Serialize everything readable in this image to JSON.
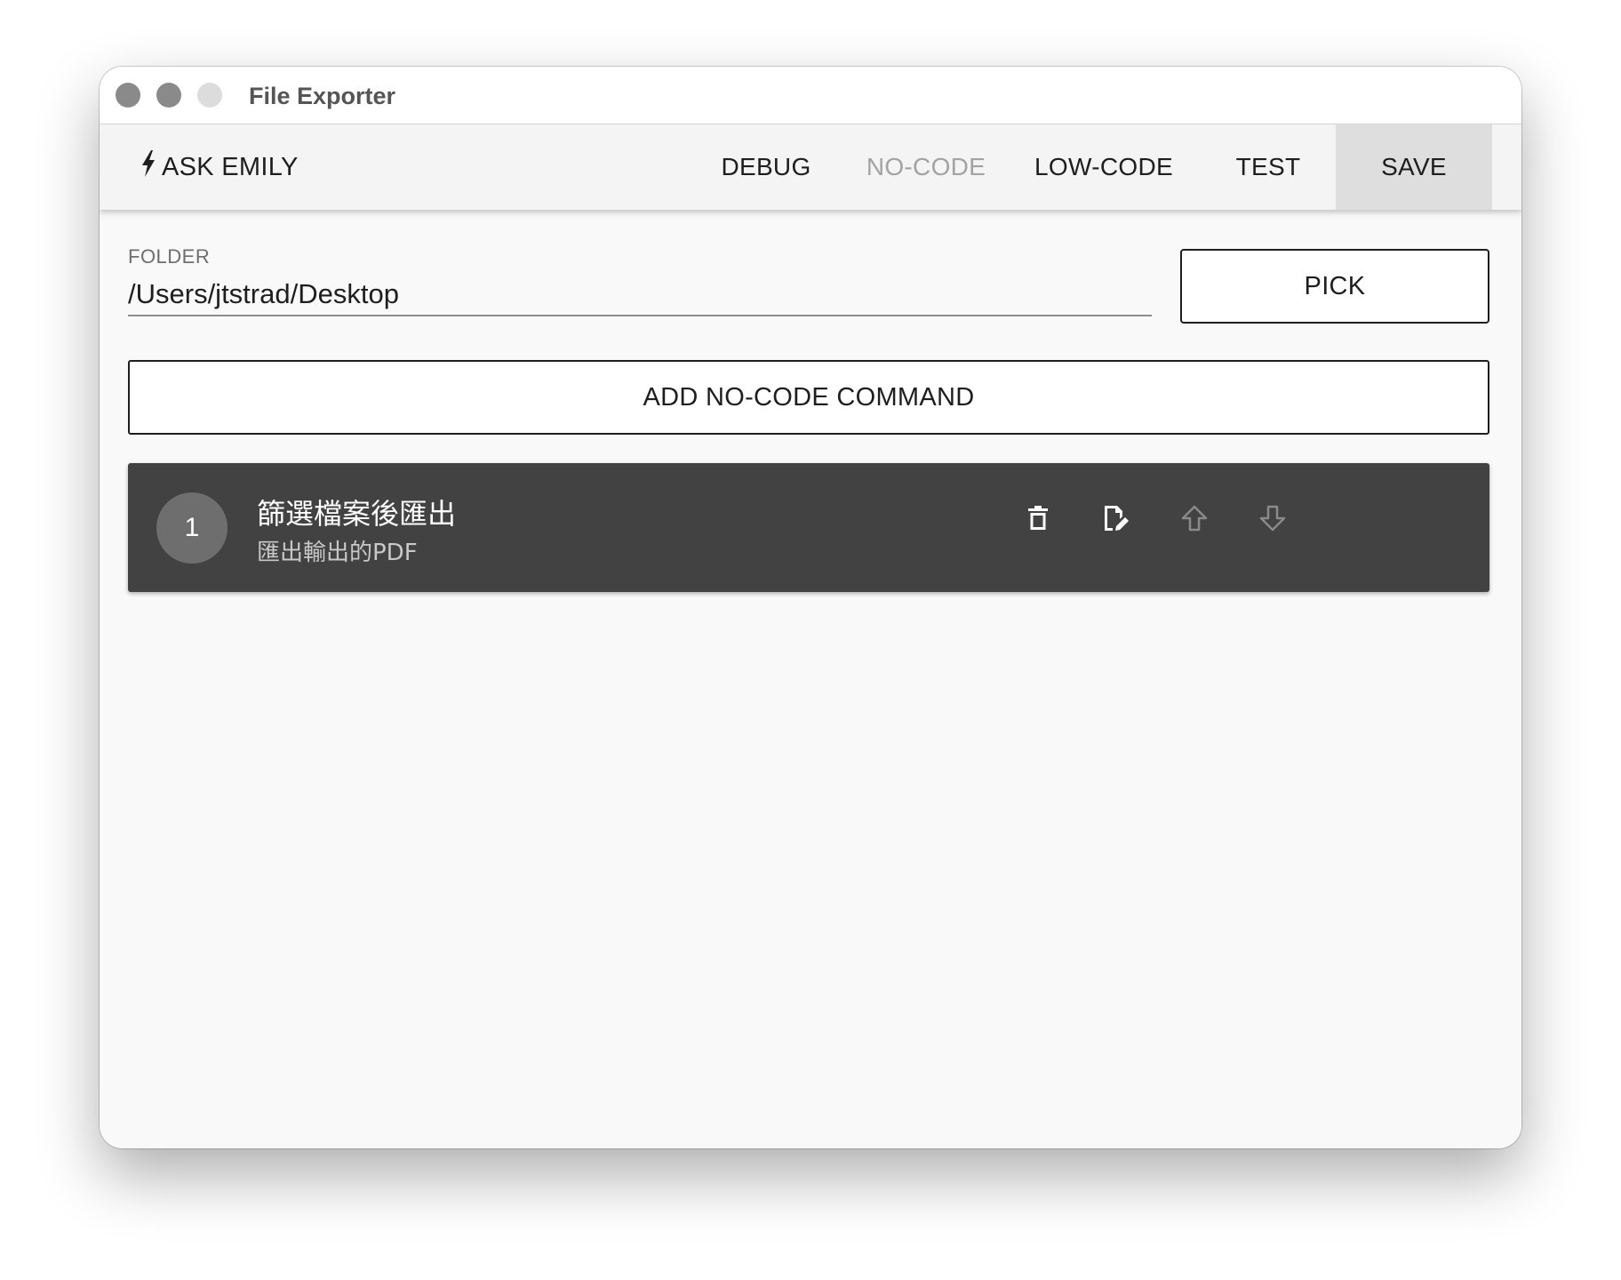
{
  "window": {
    "title": "File Exporter"
  },
  "toolbar": {
    "ask_label": "ASK EMILY",
    "ask_icon": "lightning-icon",
    "nav": [
      {
        "label": "DEBUG",
        "state": "enabled"
      },
      {
        "label": "NO-CODE",
        "state": "disabled"
      },
      {
        "label": "LOW-CODE",
        "state": "enabled"
      },
      {
        "label": "TEST",
        "state": "enabled"
      },
      {
        "label": "SAVE",
        "state": "active"
      }
    ]
  },
  "folder": {
    "label": "FOLDER",
    "value": "/Users/jtstrad/Desktop",
    "pick_label": "PICK"
  },
  "add_command": {
    "label": "ADD NO-CODE COMMAND"
  },
  "commands": [
    {
      "index": "1",
      "title": "篩選檔案後匯出",
      "subtitle": "匯出輸出的PDF",
      "actions": [
        {
          "icon": "trash-icon",
          "enabled": true
        },
        {
          "icon": "edit-file-icon",
          "enabled": true
        },
        {
          "icon": "arrow-up-icon",
          "enabled": false
        },
        {
          "icon": "arrow-down-icon",
          "enabled": false
        }
      ]
    }
  ],
  "colors": {
    "card_background": "#424242",
    "disabled_text": "#a3a3a3",
    "active_tab_background": "#dedede"
  }
}
